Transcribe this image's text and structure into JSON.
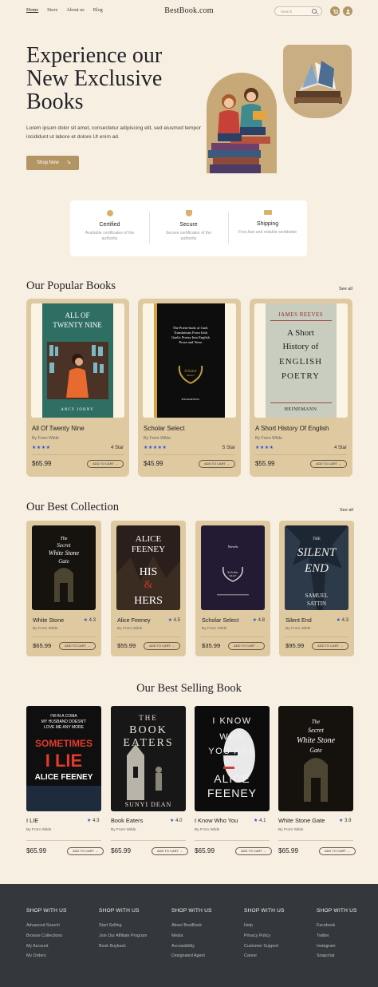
{
  "header": {
    "nav": [
      "Home",
      "Store",
      "About us",
      "Blog"
    ],
    "brand": "BestBook.com",
    "search_placeholder": "Search"
  },
  "hero": {
    "title_line1": "Experience our",
    "title_line2": "New Exclusive",
    "title_line3": "Books",
    "subtitle": "Lorem ipsum dolor sit amet, consectetur adipiscing elit, sed eiusmod tempor incididunt ut labore et dolore Ut enim ad.",
    "button": "Shop Now",
    "button_icon": "arrow-down-right-icon"
  },
  "features": [
    {
      "title": "Certified",
      "desc": "Available certificates of the authority",
      "icon": "badge-icon"
    },
    {
      "title": "Secure",
      "desc": "Secure certificates of the authority",
      "icon": "shield-icon"
    },
    {
      "title": "Shipping",
      "desc": "Free,fast and reliable worldwide",
      "icon": "truck-icon"
    }
  ],
  "popular": {
    "title": "Our Popular Books",
    "see_all": "See all",
    "items": [
      {
        "title": "All Of Twenty Nine",
        "author": "By From Wilde",
        "stars": "★★★★",
        "rating": "4 Star",
        "price": "$65.99",
        "cart": "ADD TO CART →",
        "cover_lines": [
          "ALL OF",
          "TWENTY NINE",
          "ANCY JOHNY"
        ]
      },
      {
        "title": "Scholar Select",
        "author": "By From Wilde",
        "stars": "★★★★★",
        "rating": "5 Star",
        "price": "$45.99",
        "cart": "ADD TO CART →",
        "cover_lines": [
          "The Poem-book of Gael.",
          "Translations From Irish",
          "Gaelic Poetry Into English",
          "Prose and Verse",
          "Scholar",
          "SELECT",
          "ELEANOR HULL"
        ]
      },
      {
        "title": "A Short History Of English",
        "author": "By From Wilde",
        "stars": "★★★★",
        "rating": "4 Star",
        "price": "$55.99",
        "cart": "ADD TO CART →",
        "cover_lines": [
          "JAMES REEVES",
          "A Short",
          "History of",
          "ENGLISH",
          "POETRY",
          "HEINEMANN"
        ]
      }
    ]
  },
  "collection": {
    "title": "Our Best Collection",
    "see_all": "See all",
    "items": [
      {
        "title": "White Stone",
        "rating": "4.3",
        "author": "By From Wilde",
        "price": "$65.99",
        "cart": "ADD TO CART →"
      },
      {
        "title": "Alice Feeney",
        "rating": "4.5",
        "author": "By From Wilde",
        "price": "$55.99",
        "cart": "ADD TO CART →"
      },
      {
        "title": "Scholar Select",
        "rating": "4.8",
        "author": "By From Wilde",
        "price": "$35.99",
        "cart": "ADD TO CART →"
      },
      {
        "title": "Silent End",
        "rating": "4.3",
        "author": "By From Wilde",
        "price": "$95.99",
        "cart": "ADD TO CART →"
      }
    ]
  },
  "best_selling": {
    "title": "Our Best Selling Book",
    "items": [
      {
        "title": "I LIE",
        "rating": "4.3",
        "author": "By From Wilde",
        "price": "$65.99",
        "cart": "ADD TO CART →"
      },
      {
        "title": "Book Eaters",
        "rating": "4.0",
        "author": "By From Wilde",
        "price": "$65.99",
        "cart": "ADD TO CART →"
      },
      {
        "title": "I Know Who You",
        "rating": "4.1",
        "author": "By From Wilde",
        "price": "$65.99",
        "cart": "ADD TO CART →"
      },
      {
        "title": "White Stone Gate",
        "rating": "3.9",
        "author": "By From Wilde",
        "price": "$65.99",
        "cart": "ADD TO CART →"
      }
    ]
  },
  "covers": {
    "white_stone": [
      "The",
      "Secret",
      "White Stone",
      "Gate"
    ],
    "alice": [
      "ALICE",
      "FEENEY",
      "HIS",
      "&",
      "HERS"
    ],
    "novels": [
      "Novels",
      "Scholar",
      "SELECT"
    ],
    "silent": [
      "THE",
      "SILENT",
      "END",
      "SAMUEL",
      "SATTIN"
    ],
    "ilie": [
      "I'M IN A COMA",
      "MY HUSBAND DOESN'T",
      "LOVE ME ANY MORE",
      "SOMETIMES",
      "I LIE",
      "ALICE FEENEY"
    ],
    "book_eaters": [
      "THE",
      "BOOK",
      "EATERS",
      "SUNYI DEAN"
    ],
    "iknow": [
      "I KNOW",
      "WHO",
      "YOU ARE",
      "ALICE",
      "FEENEY"
    ]
  },
  "footer": {
    "columns": [
      {
        "heading": "SHOP WITH US",
        "links": [
          "Advanced Search",
          "Browse Collections",
          "My Account",
          "My Orders"
        ]
      },
      {
        "heading": "SHOP WITH US",
        "links": [
          "Start Selling",
          "Join Our Affiliate Program",
          "Book Buyback"
        ]
      },
      {
        "heading": "SHOP WITH US",
        "links": [
          "About BestBook",
          "Media",
          "Accessibility",
          "Designated Agent"
        ]
      },
      {
        "heading": "SHOP WITH US",
        "links": [
          "Help",
          "Privacy Policy",
          "Customer Support",
          "Career"
        ]
      },
      {
        "heading": "SHOP WITH US",
        "links": [
          "Facebook",
          "Twitter",
          "Instagram",
          "Snapchat"
        ]
      }
    ]
  },
  "colors": {
    "accent": "#b39565",
    "card": "#dec9a0",
    "bg": "#f7efe1",
    "footer": "#34383c",
    "star": "#2756d8"
  }
}
